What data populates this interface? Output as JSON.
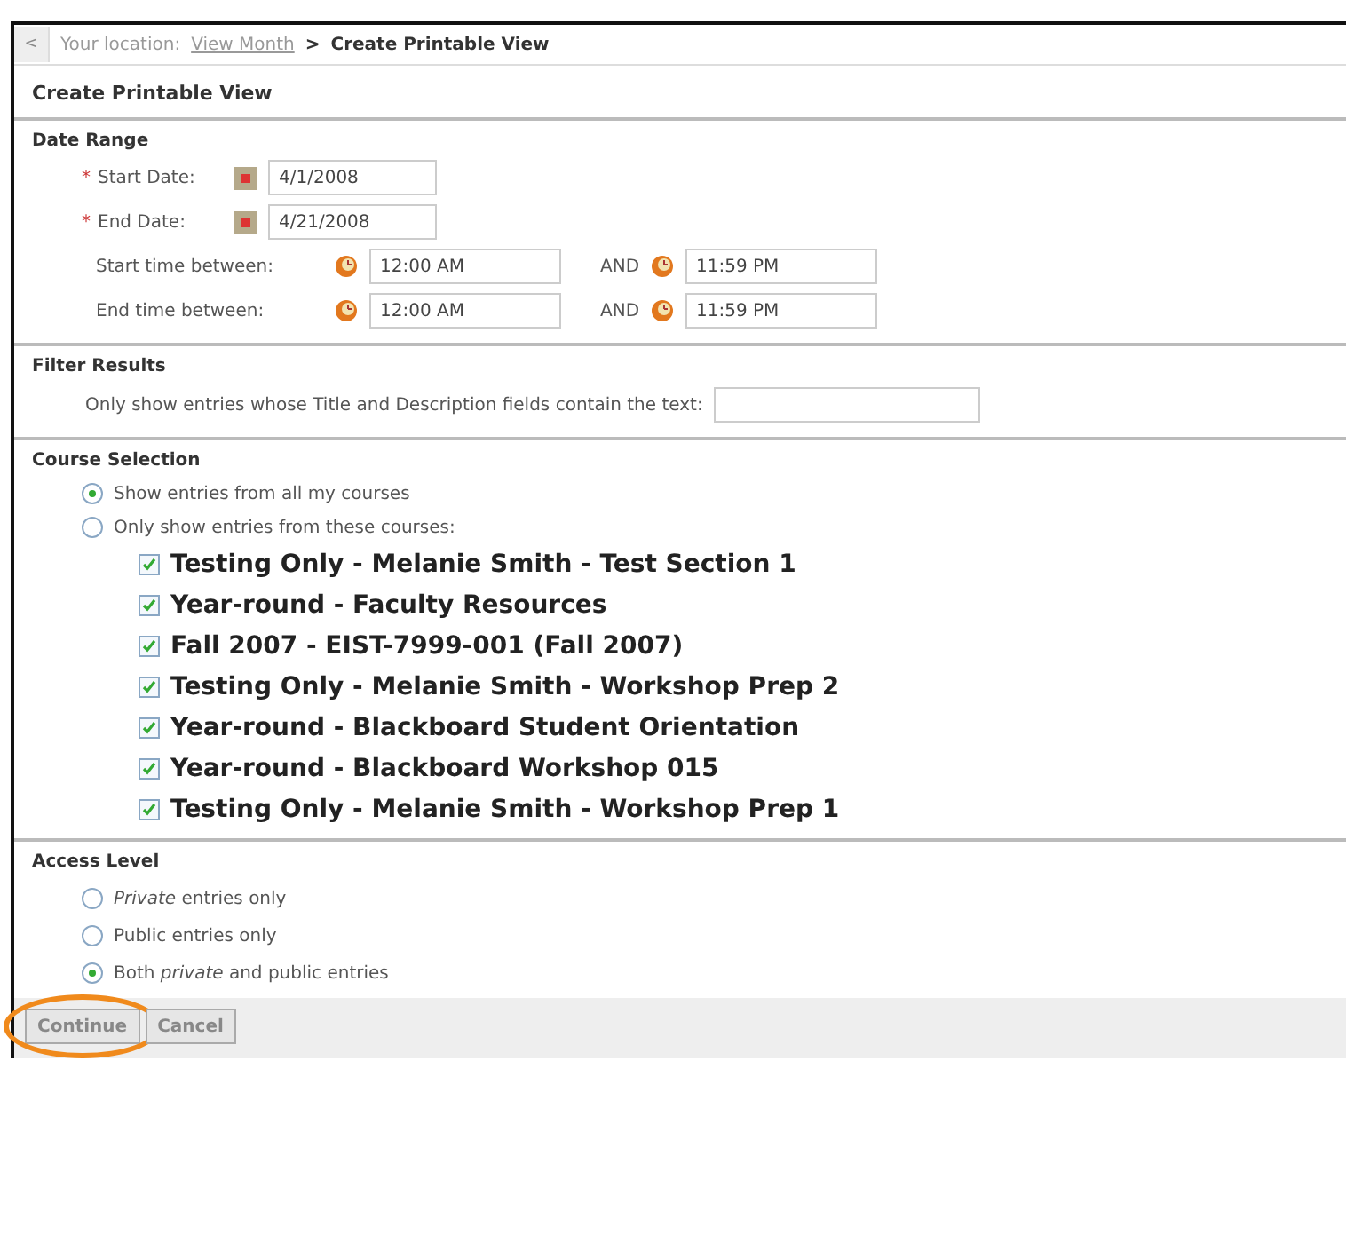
{
  "breadcrumb": {
    "back": "<",
    "prefix": "Your location:",
    "link": "View Month",
    "separator": ">",
    "current": "Create Printable View"
  },
  "title": "Create Printable View",
  "date_range": {
    "heading": "Date Range",
    "dates": [
      {
        "label": "Start Date:",
        "marker": "*",
        "value": "4/1/2008"
      },
      {
        "label": "End Date:",
        "marker": "*",
        "value": "4/21/2008"
      }
    ],
    "times": [
      {
        "label": "Start time between:",
        "from": "12:00 AM",
        "joiner": "AND",
        "to": "11:59 PM"
      },
      {
        "label": "End time between:",
        "from": "12:00 AM",
        "joiner": "AND",
        "to": "11:59 PM"
      }
    ]
  },
  "filter": {
    "heading": "Filter Results",
    "label": "Only show entries whose Title and Description fields contain the text:"
  },
  "course_selection": {
    "heading": "Course Selection",
    "options": [
      {
        "label": "Show entries from all my courses",
        "selected": true
      },
      {
        "label": "Only show entries from these courses:",
        "selected": false
      }
    ],
    "courses": [
      {
        "label": "Testing Only - Melanie Smith - Test Section 1",
        "checked": true
      },
      {
        "label": "Year-round - Faculty Resources",
        "checked": true
      },
      {
        "label": "Fall 2007 - EIST-7999-001 (Fall 2007)",
        "checked": true
      },
      {
        "label": "Testing Only - Melanie Smith - Workshop Prep 2",
        "checked": true
      },
      {
        "label": "Year-round - Blackboard Student Orientation",
        "checked": true
      },
      {
        "label": "Year-round - Blackboard Workshop 015",
        "checked": true
      },
      {
        "label": "Testing Only - Melanie Smith - Workshop Prep 1",
        "checked": true
      }
    ]
  },
  "access_level": {
    "heading": "Access Level",
    "options": [
      {
        "label": "*Private* entries only",
        "selected": false
      },
      {
        "label": "Public entries only",
        "selected": false
      },
      {
        "label": "Both *private* and public entries",
        "selected": true
      }
    ]
  },
  "buttons": [
    {
      "label": "Continue",
      "highlighted": true
    },
    {
      "label": "Cancel",
      "highlighted": false
    }
  ]
}
